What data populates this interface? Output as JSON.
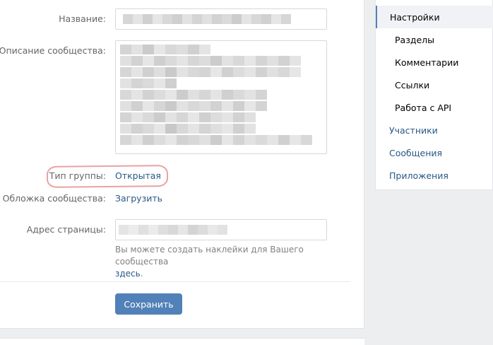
{
  "form": {
    "name_label": "Название:",
    "description_label": "Описание сообщества:",
    "group_type_label": "Тип группы:",
    "group_type_value": "Открытая",
    "cover_label": "Обложка сообщества:",
    "cover_action": "Загрузить",
    "address_label": "Адрес страницы:",
    "hint_text": "Вы можете создать наклейки для Вашего сообщества",
    "hint_link": "здесь",
    "hint_end": ".",
    "save_label": "Сохранить"
  },
  "menu": {
    "items": [
      {
        "label": "Настройки"
      },
      {
        "label": "Разделы"
      },
      {
        "label": "Комментарии"
      },
      {
        "label": "Ссылки"
      },
      {
        "label": "Работа с API"
      },
      {
        "label": "Участники"
      },
      {
        "label": "Сообщения"
      },
      {
        "label": "Приложения"
      }
    ]
  },
  "colors": {
    "accent": "#5181b8",
    "link": "#2a5885",
    "highlight": "#e8a3a3"
  }
}
